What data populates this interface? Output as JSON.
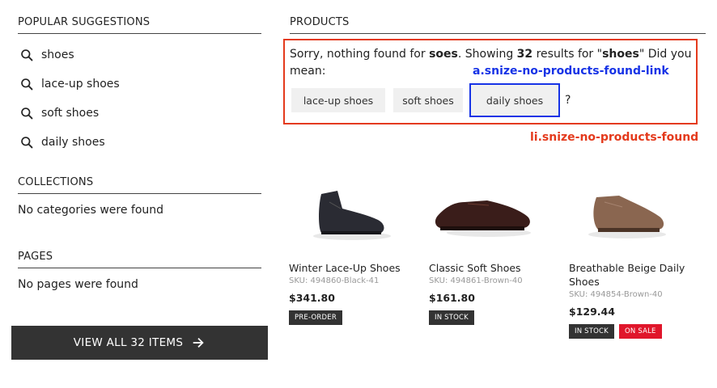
{
  "popular": {
    "title": "POPULAR SUGGESTIONS",
    "items": [
      {
        "label": "shoes",
        "icon": "search-icon"
      },
      {
        "label": "lace-up shoes",
        "icon": "search-icon"
      },
      {
        "label": "soft shoes",
        "icon": "search-icon"
      },
      {
        "label": "daily shoes",
        "icon": "search-icon"
      }
    ]
  },
  "collections": {
    "title": "COLLECTIONS",
    "empty": "No categories were found"
  },
  "pages": {
    "title": "PAGES",
    "empty": "No pages were found"
  },
  "view_all": {
    "label": "VIEW ALL 32 ITEMS",
    "icon": "arrow-right-icon"
  },
  "products": {
    "title": "PRODUCTS",
    "message": {
      "sorry": "Sorry, nothing found for ",
      "query": "soes",
      "showing": ". Showing ",
      "count": "32",
      "results_for": " results for \"",
      "term": "shoes",
      "did_you_mean": "\" Did you mean:"
    },
    "chips": [
      "lace-up shoes",
      "soft shoes",
      "daily shoes"
    ],
    "question": "?",
    "annotations": {
      "link": "a.snize-no-products-found-link",
      "container": "li.snize-no-products-found"
    },
    "colors": {
      "annotation_red": "#e43a1c",
      "annotation_blue": "#1733e6",
      "sale": "#e0162b"
    },
    "items": [
      {
        "name": "Winter Lace-Up Shoes",
        "sku": "SKU: 494860-Black-41",
        "price": "$341.80",
        "badges": [
          {
            "label": "PRE-ORDER",
            "type": "dark"
          }
        ],
        "shoe_color": "#2a2b33"
      },
      {
        "name": "Classic Soft Shoes",
        "sku": "SKU: 494861-Brown-40",
        "price": "$161.80",
        "badges": [
          {
            "label": "IN STOCK",
            "type": "dark"
          }
        ],
        "shoe_color": "#3a1d1a"
      },
      {
        "name": "Breathable Beige Daily Shoes",
        "sku": "SKU: 494854-Brown-40",
        "price": "$129.44",
        "badges": [
          {
            "label": "IN STOCK",
            "type": "dark"
          },
          {
            "label": "ON SALE",
            "type": "sale"
          }
        ],
        "shoe_color": "#8a6650"
      }
    ]
  }
}
